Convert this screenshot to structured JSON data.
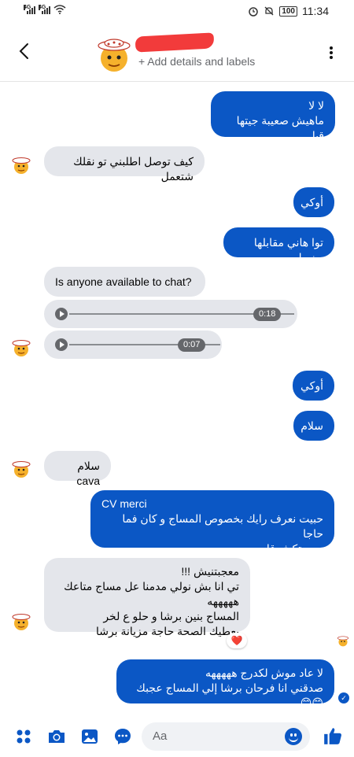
{
  "status_bar": {
    "network_left": "4G",
    "network_right": "4G",
    "battery": "100",
    "time": "11:34"
  },
  "header": {
    "subtitle": "+ Add details and labels"
  },
  "messages": {
    "m1": {
      "line1": "لا لا",
      "line2": "ماهيش صعيبة جيتها قبل"
    },
    "m2": "كيف توصل اطلبني تو نقلك شتعمل",
    "m3": "أوكي",
    "m4": "توا هاني مقابلها بضبط",
    "m5": "Is anyone available to chat?",
    "voice1": {
      "duration": "0:18"
    },
    "voice2": {
      "duration": "0:07"
    },
    "m6": "أوكي",
    "m7": "سلام",
    "m8": "سلام cava",
    "m9": {
      "line1": "CV merci",
      "line2": "حبيت نعرف رايك بخصوص المساج و كان فما حاجا",
      "line3": "معجبتكش قلي"
    },
    "m10": {
      "line1": "معجبتنيش !!!",
      "line2": "تي انا بش نولي مدمنا عل مساج متاعك هههههه",
      "line3": "المساج بنين برشا و حلو ع لخر",
      "line4": "يعطيك الصحة حاجة مزيانة برشا",
      "reaction": "❤️"
    },
    "m11": {
      "line1": "لا عاد موش لكدرج هههههه",
      "line2": "صدقني انا فرحان برشا إلي المساج عجبك 😊😊"
    }
  },
  "composer": {
    "placeholder": "Aa"
  },
  "colors": {
    "accent": "#0b57c5",
    "incoming_bubble": "#e4e6eb",
    "muted_text": "#65676b"
  },
  "icons": [
    "back-arrow-icon",
    "more-options-icon",
    "apps-icon",
    "camera-icon",
    "gallery-icon",
    "messenger-icon",
    "emoji-icon",
    "thumbs-up-icon"
  ]
}
